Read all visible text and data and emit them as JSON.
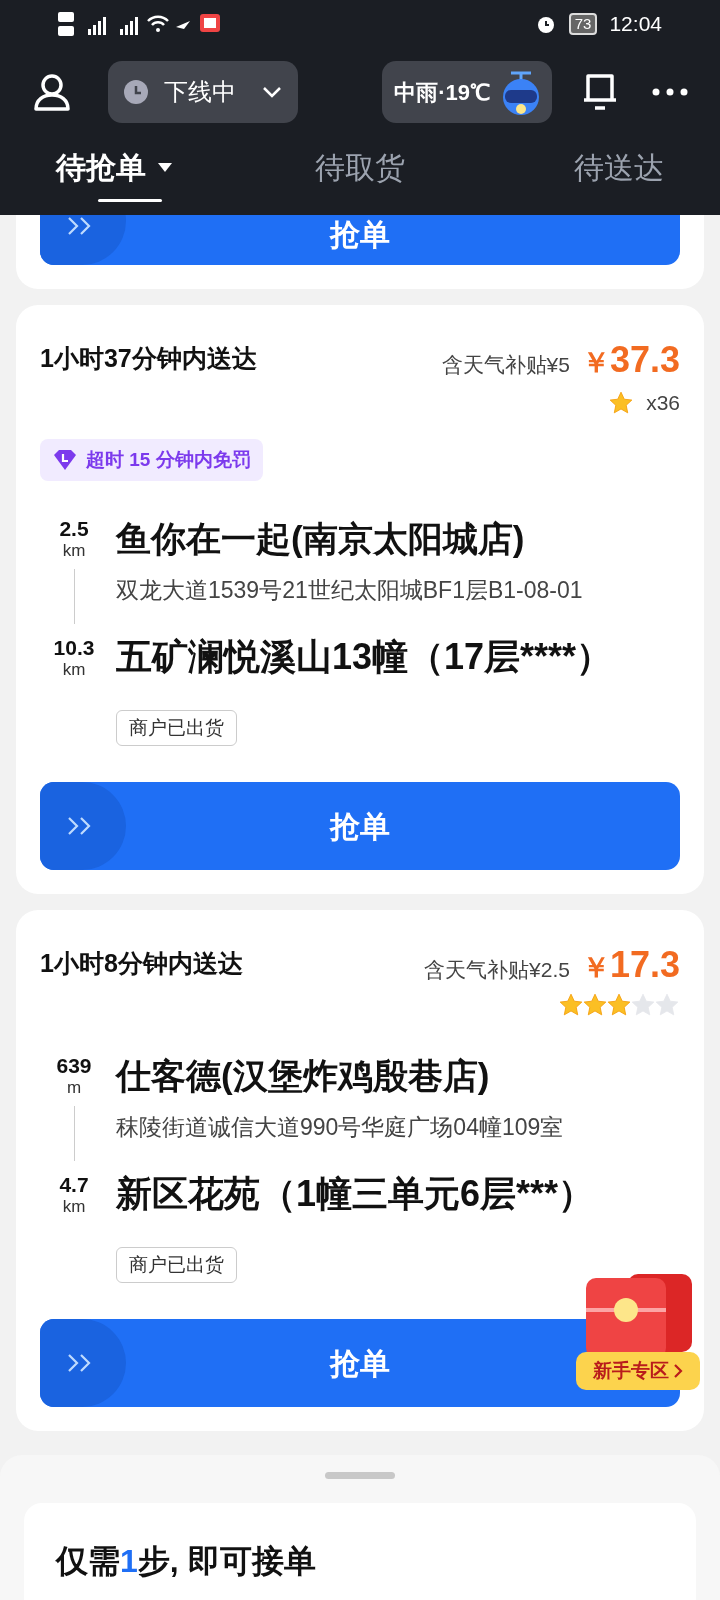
{
  "status_bar": {
    "time": "12:04",
    "battery": "73"
  },
  "toolbar": {
    "status": {
      "label": "下线中"
    },
    "weather": {
      "label": "中雨·19℃"
    }
  },
  "tabs": [
    {
      "label": "待抢单",
      "selected": true,
      "dropdown": true
    },
    {
      "label": "待取货",
      "selected": false,
      "dropdown": false
    },
    {
      "label": "待送达",
      "selected": false,
      "dropdown": false
    }
  ],
  "previous_order": {
    "button": "抢单"
  },
  "orders": [
    {
      "deadline": "1小时37分钟内送达",
      "subsidy": "含天气补贴¥5",
      "currency": "￥",
      "price": "37.3",
      "rating": {
        "kind": "multiplier",
        "label": "x36"
      },
      "badge": "超时 15 分钟内免罚",
      "pickup": {
        "distance": "2.5",
        "unit": "km",
        "name": "鱼你在一起(南京太阳城店)",
        "address": "双龙大道1539号21世纪太阳城BF1层B1-08-01"
      },
      "dropoff": {
        "distance": "10.3",
        "unit": "km",
        "name": "五矿澜悦溪山13幢（17层****）"
      },
      "tag": "商户已出货",
      "button": "抢单"
    },
    {
      "deadline": "1小时8分钟内送达",
      "subsidy": "含天气补贴¥2.5",
      "currency": "￥",
      "price": "17.3",
      "rating": {
        "kind": "stars",
        "stars": 3
      },
      "pickup": {
        "distance": "639",
        "unit": "m",
        "name": "仕客德(汉堡炸鸡殷巷店)",
        "address": "秣陵街道诚信大道990号华庭广场04幢109室"
      },
      "dropoff": {
        "distance": "4.7",
        "unit": "km",
        "name": "新区花苑（1幢三单元6层***）"
      },
      "tag": "商户已出货",
      "button": "抢单"
    }
  ],
  "promo": {
    "label": "新手专区"
  },
  "bottom_sheet": {
    "parts": [
      {
        "text": "仅需",
        "highlight": false
      },
      {
        "text": "1",
        "highlight": true
      },
      {
        "text": "步, 即可接单",
        "highlight": false
      }
    ]
  }
}
